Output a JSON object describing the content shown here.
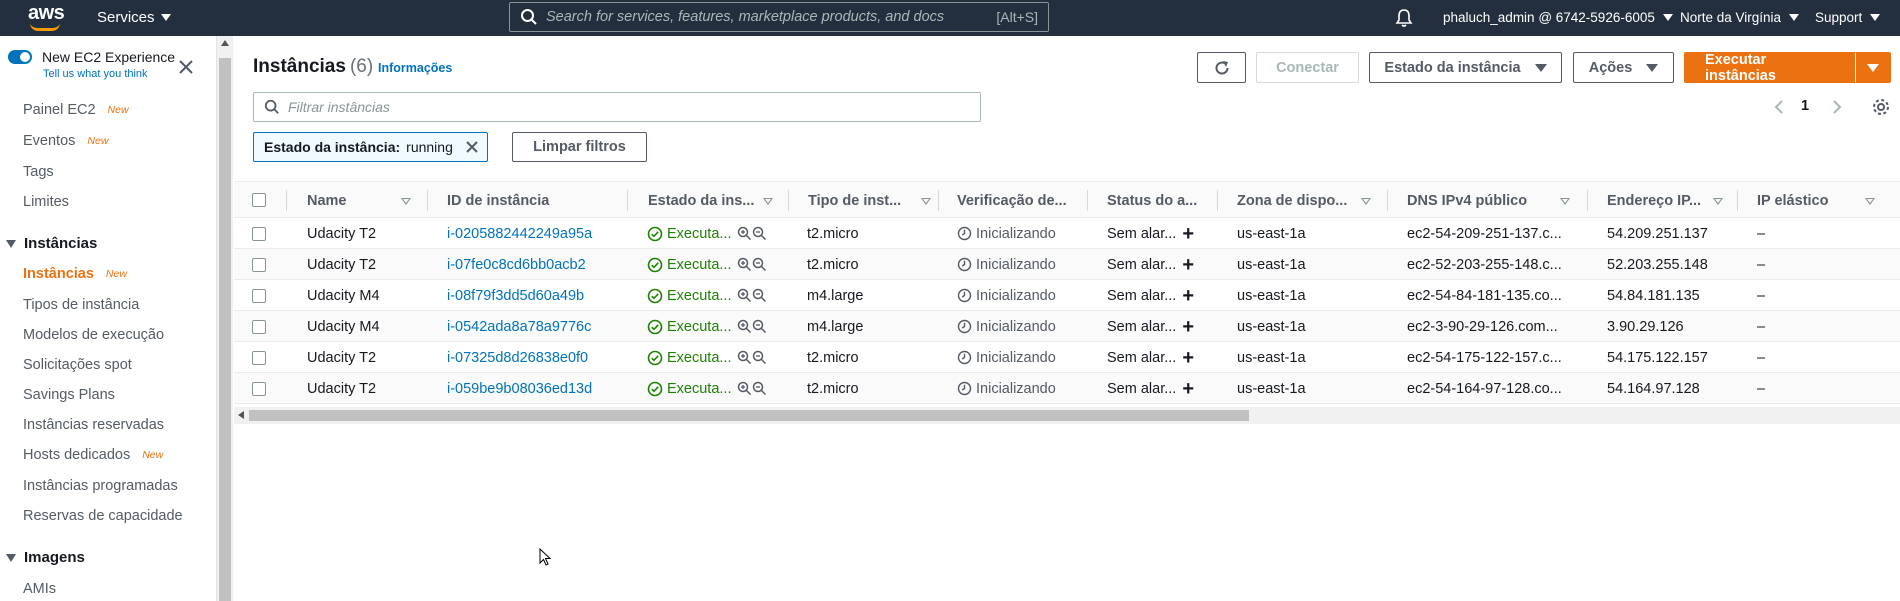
{
  "topnav": {
    "logo_text": "aws",
    "services_label": "Services",
    "search_placeholder": "Search for services, features, marketplace products, and docs",
    "search_shortcut": "[Alt+S]",
    "account": "phaluch_admin @ 6742-5926-6005",
    "region": "Norte da Virgínia",
    "support": "Support"
  },
  "sidebar": {
    "new_experience": "New EC2 Experience",
    "tell_us": "Tell us what you think",
    "new_badge": "New",
    "items": [
      {
        "label": "Painel EC2",
        "new": true
      },
      {
        "label": "Eventos",
        "new": true
      },
      {
        "label": "Tags",
        "new": false
      },
      {
        "label": "Limites",
        "new": false
      }
    ],
    "section_instances": "Instâncias",
    "instance_items": [
      {
        "label": "Instâncias",
        "new": true
      },
      {
        "label": "Tipos de instância",
        "new": false
      },
      {
        "label": "Modelos de execução",
        "new": false
      },
      {
        "label": "Solicitações spot",
        "new": false
      },
      {
        "label": "Savings Plans",
        "new": false
      },
      {
        "label": "Instâncias reservadas",
        "new": false
      },
      {
        "label": "Hosts dedicados",
        "new": true
      },
      {
        "label": "Instâncias programadas",
        "new": false
      },
      {
        "label": "Reservas de capacidade",
        "new": false
      }
    ],
    "section_images": "Imagens",
    "image_items": [
      {
        "label": "AMIs"
      }
    ]
  },
  "header": {
    "title": "Instâncias",
    "count": "(6)",
    "info": "Informações",
    "connect": "Conectar",
    "instance_state": "Estado da instância",
    "actions": "Ações",
    "launch": "Executar instâncias"
  },
  "filter": {
    "placeholder": "Filtrar instâncias",
    "chip_key": "Estado da instância:",
    "chip_value": "running",
    "clear": "Limpar filtros",
    "page": "1"
  },
  "table": {
    "columns": [
      "Name",
      "ID de instância",
      "Estado da ins...",
      "Tipo de inst...",
      "Verificação de...",
      "Status do a...",
      "Zona de dispo...",
      "DNS IPv4 público",
      "Endereço IP...",
      "IP elástico"
    ],
    "rows": [
      {
        "name": "Udacity T2",
        "id": "i-0205882442249a95a",
        "state": "Executa...",
        "type": "t2.micro",
        "check": "Inicializando",
        "alarm": "Sem alar...",
        "zone": "us-east-1a",
        "dns": "ec2-54-209-251-137.c...",
        "ip": "54.209.251.137",
        "eip": "–"
      },
      {
        "name": "Udacity T2",
        "id": "i-07fe0c8cd6bb0acb2",
        "state": "Executa...",
        "type": "t2.micro",
        "check": "Inicializando",
        "alarm": "Sem alar...",
        "zone": "us-east-1a",
        "dns": "ec2-52-203-255-148.c...",
        "ip": "52.203.255.148",
        "eip": "–"
      },
      {
        "name": "Udacity M4",
        "id": "i-08f79f3dd5d60a49b",
        "state": "Executa...",
        "type": "m4.large",
        "check": "Inicializando",
        "alarm": "Sem alar...",
        "zone": "us-east-1a",
        "dns": "ec2-54-84-181-135.co...",
        "ip": "54.84.181.135",
        "eip": "–"
      },
      {
        "name": "Udacity M4",
        "id": "i-0542ada8a78a9776c",
        "state": "Executa...",
        "type": "m4.large",
        "check": "Inicializando",
        "alarm": "Sem alar...",
        "zone": "us-east-1a",
        "dns": "ec2-3-90-29-126.com...",
        "ip": "3.90.29.126",
        "eip": "–"
      },
      {
        "name": "Udacity T2",
        "id": "i-07325d8d26838e0f0",
        "state": "Executa...",
        "type": "t2.micro",
        "check": "Inicializando",
        "alarm": "Sem alar...",
        "zone": "us-east-1a",
        "dns": "ec2-54-175-122-157.c...",
        "ip": "54.175.122.157",
        "eip": "–"
      },
      {
        "name": "Udacity T2",
        "id": "i-059be9b08036ed13d",
        "state": "Executa...",
        "type": "t2.micro",
        "check": "Inicializando",
        "alarm": "Sem alar...",
        "zone": "us-east-1a",
        "dns": "ec2-54-164-97-128.co...",
        "ip": "54.164.97.128",
        "eip": "–"
      }
    ]
  },
  "colors": {
    "nav_bg": "#232f3e",
    "accent": "#ec7211",
    "link": "#0073bb",
    "success": "#1d8102"
  }
}
